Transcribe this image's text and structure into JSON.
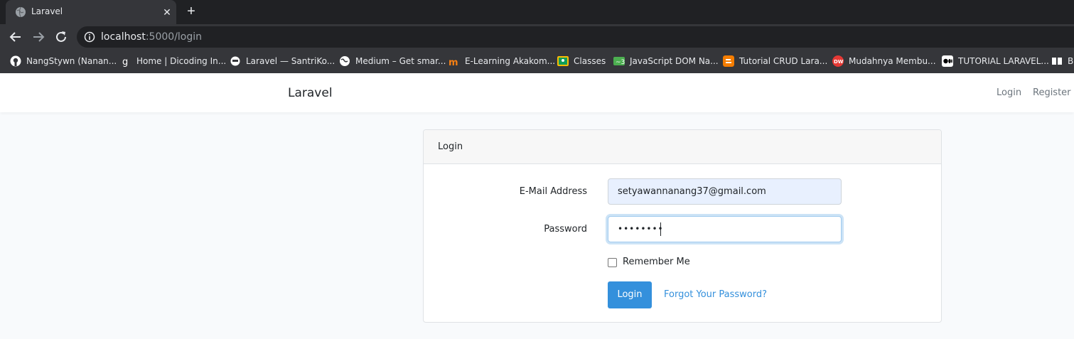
{
  "browser": {
    "tab": {
      "title": "Laravel",
      "close": "✕"
    },
    "new_tab": "+",
    "url": {
      "host": "localhost",
      "rest": ":5000/login"
    },
    "bookmarks": [
      {
        "label": "NangStywn (Nanan...",
        "icon": "github-icon",
        "color": "#ffffff"
      },
      {
        "label": "Home | Dicoding In...",
        "icon": "dicoding-icon",
        "color": "#ffffff"
      },
      {
        "label": "Laravel — SantriKo...",
        "icon": "santrikoding-icon",
        "color": "#ffffff"
      },
      {
        "label": "Medium – Get smar...",
        "icon": "globe-icon",
        "color": "#ffffff"
      },
      {
        "label": "E-Learning Akakom...",
        "icon": "moodle-icon",
        "color": "#f98012"
      },
      {
        "label": "Classes",
        "icon": "classroom-icon",
        "color": "#fbbc04"
      },
      {
        "label": "JavaScript DOM Na...",
        "icon": "dom-icon",
        "color": "#4caf50"
      },
      {
        "label": "Tutorial CRUD Lara...",
        "icon": "blogger-icon",
        "color": "#f57d00"
      },
      {
        "label": "Mudahnya Membu...",
        "icon": "dw-icon",
        "color": "#e53935"
      },
      {
        "label": "TUTORIAL LARAVEL...",
        "icon": "medium-icon",
        "color": "#000000"
      },
      {
        "label": "Bl",
        "icon": "bookmark-icon",
        "color": "#000000"
      }
    ]
  },
  "navbar": {
    "brand": "Laravel",
    "login": "Login",
    "register": "Register"
  },
  "card": {
    "header": "Login",
    "email_label": "E-Mail Address",
    "email_value": "setyawannanang37@gmail.com",
    "password_label": "Password",
    "password_value": "••••••••",
    "remember_label": "Remember Me",
    "login_button": "Login",
    "forgot_link": "Forgot Your Password?"
  },
  "colors": {
    "primary": "#3490dc",
    "page_bg": "#f8fafc",
    "autofill": "#e8f0fe"
  }
}
